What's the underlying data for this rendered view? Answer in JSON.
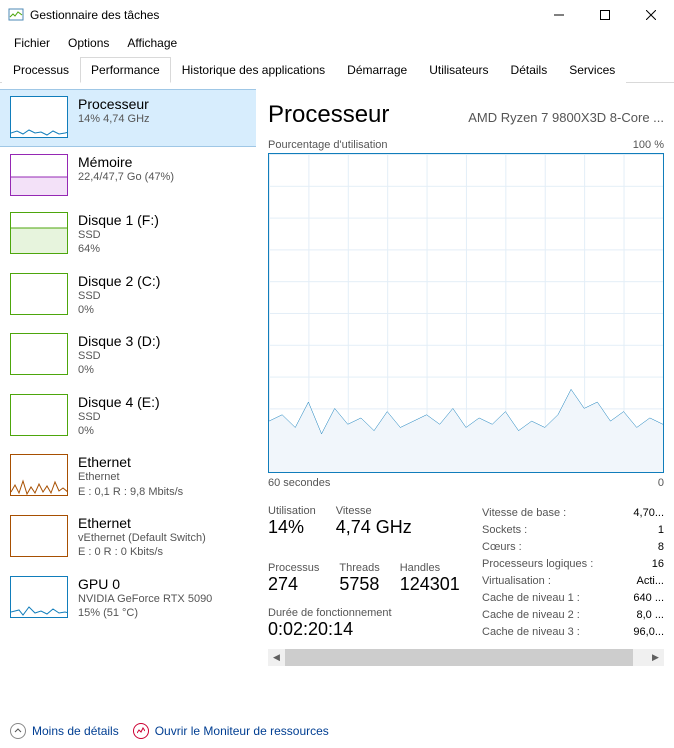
{
  "window": {
    "title": "Gestionnaire des tâches"
  },
  "menus": {
    "file": "Fichier",
    "options": "Options",
    "view": "Affichage"
  },
  "tabs": {
    "processes": "Processus",
    "performance": "Performance",
    "apphistory": "Historique des applications",
    "startup": "Démarrage",
    "users": "Utilisateurs",
    "details": "Détails",
    "services": "Services"
  },
  "sidebar": [
    {
      "title": "Processeur",
      "sub": "14%  4,74 GHz",
      "kind": "cpu",
      "selected": true
    },
    {
      "title": "Mémoire",
      "sub": "22,4/47,7 Go (47%)",
      "kind": "mem"
    },
    {
      "title": "Disque 1 (F:)",
      "sub": "SSD\n64%",
      "kind": "disk"
    },
    {
      "title": "Disque 2 (C:)",
      "sub": "SSD\n0%",
      "kind": "disk"
    },
    {
      "title": "Disque 3 (D:)",
      "sub": "SSD\n0%",
      "kind": "disk"
    },
    {
      "title": "Disque 4 (E:)",
      "sub": "SSD\n0%",
      "kind": "disk"
    },
    {
      "title": "Ethernet",
      "sub": "Ethernet\nE : 0,1 R : 9,8 Mbits/s",
      "kind": "eth"
    },
    {
      "title": "Ethernet",
      "sub": "vEthernet (Default Switch)\nE : 0 R : 0 Kbits/s",
      "kind": "eth"
    },
    {
      "title": "GPU 0",
      "sub": "NVIDIA GeForce RTX 5090\n15% (51 °C)",
      "kind": "gpu"
    }
  ],
  "detail": {
    "title": "Processeur",
    "subtitle": "AMD Ryzen 7 9800X3D 8-Core ...",
    "chart_top_left": "Pourcentage d'utilisation",
    "chart_top_right": "100 %",
    "chart_bottom_left": "60 secondes",
    "chart_bottom_right": "0",
    "stats": {
      "util_label": "Utilisation",
      "util": "14%",
      "speed_label": "Vitesse",
      "speed": "4,74 GHz",
      "proc_label": "Processus",
      "proc": "274",
      "threads_label": "Threads",
      "threads": "5758",
      "handles_label": "Handles",
      "handles": "124301",
      "uptime_label": "Durée de fonctionnement",
      "uptime": "0:02:20:14"
    },
    "side": [
      {
        "k": "Vitesse de base :",
        "v": "4,70..."
      },
      {
        "k": "Sockets :",
        "v": "1"
      },
      {
        "k": "Cœurs :",
        "v": "8"
      },
      {
        "k": "Processeurs logiques :",
        "v": "16"
      },
      {
        "k": "Virtualisation :",
        "v": "Acti..."
      },
      {
        "k": "Cache de niveau 1 :",
        "v": "640 ..."
      },
      {
        "k": "Cache de niveau 2 :",
        "v": "8,0 ..."
      },
      {
        "k": "Cache de niveau 3 :",
        "v": "96,0..."
      }
    ]
  },
  "footer": {
    "less": "Moins de détails",
    "resmon": "Ouvrir le Moniteur de ressources"
  },
  "chart_data": {
    "type": "line",
    "title": "Pourcentage d'utilisation",
    "xlabel": "secondes",
    "ylabel": "%",
    "xlim": [
      60,
      0
    ],
    "ylim": [
      0,
      100
    ],
    "x": [
      60,
      58,
      56,
      54,
      52,
      50,
      48,
      46,
      44,
      42,
      40,
      38,
      36,
      34,
      32,
      30,
      28,
      26,
      24,
      22,
      20,
      18,
      16,
      14,
      12,
      10,
      8,
      6,
      4,
      2,
      0
    ],
    "values": [
      16,
      18,
      14,
      22,
      12,
      20,
      15,
      17,
      13,
      19,
      14,
      16,
      18,
      15,
      20,
      14,
      17,
      15,
      19,
      13,
      16,
      14,
      18,
      26,
      20,
      22,
      16,
      19,
      14,
      17,
      15
    ]
  }
}
